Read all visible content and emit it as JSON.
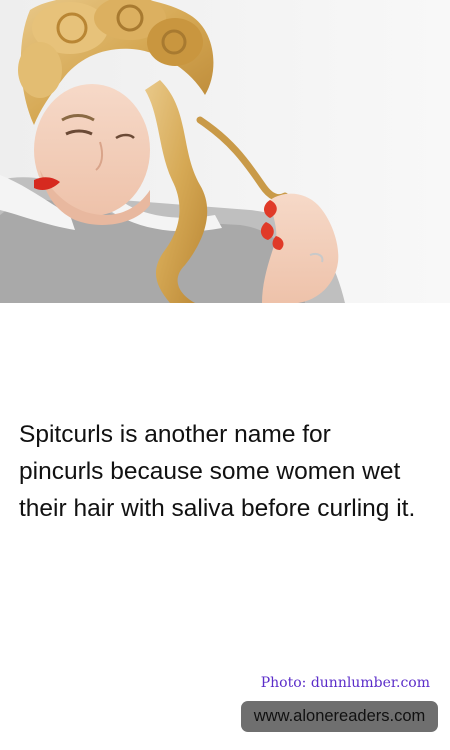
{
  "fact": {
    "text": "Spitcurls is another name for pincurls because some women wet their hair with saliva before curling it."
  },
  "photo": {
    "credit": "Photo: dunnlumber.com",
    "credit_color": "#5b2dc9"
  },
  "footer": {
    "site_url": "www.alonereaders.com",
    "badge_color": "#6f6f6f"
  }
}
